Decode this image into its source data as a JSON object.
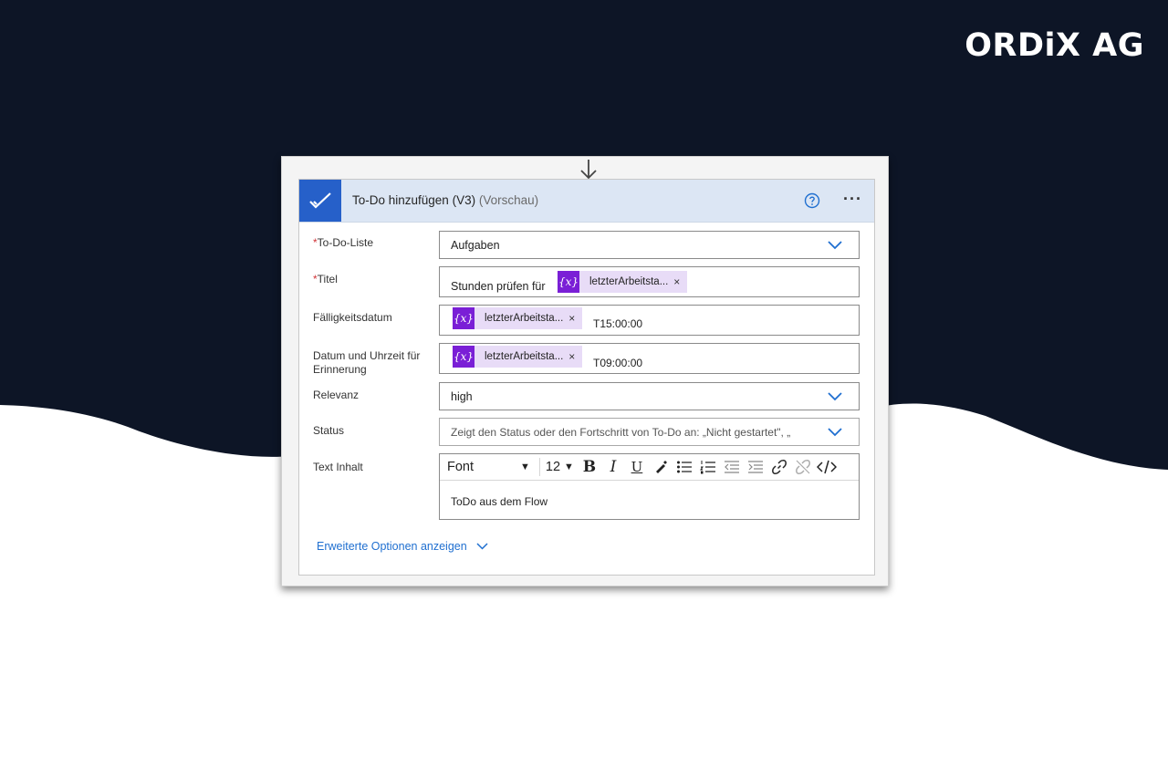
{
  "brand": {
    "logo_text": "ORDiX AG"
  },
  "card": {
    "title": "To-Do hinzufügen (V3)",
    "subtitle": "(Vorschau)",
    "icons": {
      "app": "checkmark-icon",
      "help": "help-icon",
      "more": "more-options-icon"
    }
  },
  "fields": {
    "todo_list": {
      "required_mark": "*",
      "label": "To-Do-Liste",
      "value": "Aufgaben"
    },
    "title": {
      "required_mark": "*",
      "label": "Titel",
      "prefix": "Stunden prüfen für",
      "token": "letzterArbeitsta...",
      "token_icon": "{x}",
      "remove": "×"
    },
    "due_date": {
      "label": "Fälligkeitsdatum",
      "token": "letzterArbeitsta...",
      "token_icon": "{x}",
      "remove": "×",
      "suffix": "T15:00:00"
    },
    "reminder": {
      "label": "Datum und Uhrzeit für Erinnerung",
      "token": "letzterArbeitsta...",
      "token_icon": "{x}",
      "remove": "×",
      "suffix": "T09:00:00"
    },
    "relevance": {
      "label": "Relevanz",
      "value": "high"
    },
    "status": {
      "label": "Status",
      "placeholder": "Zeigt den Status oder den Fortschritt von To-Do an: „Nicht gestartet\", „"
    },
    "body": {
      "label": "Text Inhalt",
      "font": "Font",
      "font_size": "12",
      "bold": "B",
      "italic": "I",
      "underline": "U",
      "content": "ToDo aus dem Flow"
    }
  },
  "advanced_options": "Erweiterte Optionen anzeigen",
  "colors": {
    "navy": "#0d1526",
    "header_blue": "#dce6f4",
    "app_blue": "#2660c9",
    "token_purple": "#7a1fd6",
    "link_blue": "#1f6fd0"
  }
}
